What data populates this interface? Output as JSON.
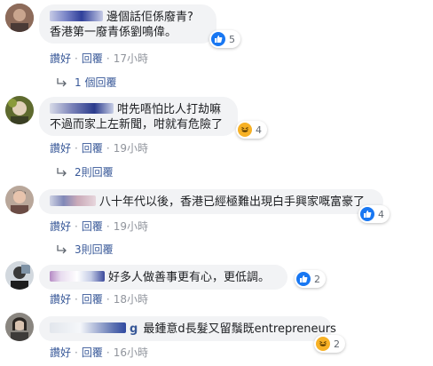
{
  "comments": [
    {
      "text_line1": "邊個話佢係廢青?",
      "text_line2": "香港第一廢青係劉鳴偉。",
      "reaction_type": "like",
      "reaction_count": "5",
      "like_label": "讚好",
      "reply_label": "回覆",
      "time": "17小時",
      "replies_label": "1 個回覆"
    },
    {
      "text_line1": "咁先唔怕比人打劫嘛",
      "text_line2": "不過而家上左新聞，咁就有危險了",
      "reaction_type": "haha",
      "reaction_count": "4",
      "like_label": "讚好",
      "reply_label": "回覆",
      "time": "19小時",
      "replies_label": "2則回覆"
    },
    {
      "text_line1": "八十年代以後，香港已經極難出現白手興家嘅富豪了",
      "reaction_type": "like",
      "reaction_count": "4",
      "like_label": "讚好",
      "reply_label": "回覆",
      "time": "19小時",
      "replies_label": "3則回覆"
    },
    {
      "text_line1": "好多人做善事更有心，更低調。",
      "reaction_type": "like",
      "reaction_count": "2",
      "like_label": "讚好",
      "reply_label": "回覆",
      "time": "18小時"
    },
    {
      "name_visible": "g",
      "text_line1": "最鍾意d長髮又留鬚既entrepreneurs",
      "reaction_type": "haha",
      "reaction_count": "2",
      "like_label": "讚好",
      "reply_label": "回覆",
      "time": "16小時"
    }
  ],
  "colors": {
    "link": "#385898",
    "muted": "#90949c",
    "bubble": "#f2f3f5",
    "like_blue": "#1877f2",
    "haha_yellow": "#f7b125"
  }
}
